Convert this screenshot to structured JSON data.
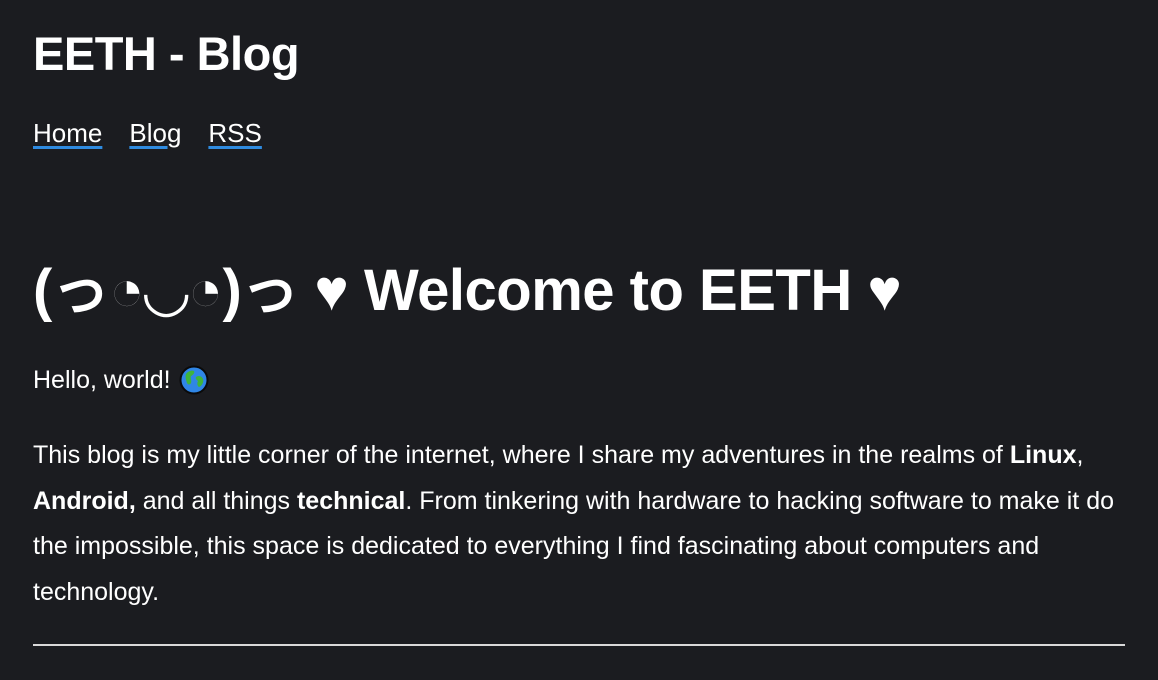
{
  "header": {
    "site_title": "EETH - Blog",
    "nav": [
      {
        "label": "Home"
      },
      {
        "label": "Blog"
      },
      {
        "label": "RSS"
      }
    ]
  },
  "main": {
    "heading": "(っ◔◡◔)っ ♥ Welcome to EETH ♥",
    "hello_text": "Hello, world!",
    "hello_icon": "globe-icon",
    "intro": {
      "part1": "This blog is my little corner of the internet, where I share my adventures in the realms of ",
      "bold_linux": "Linux",
      "sep1": ", ",
      "bold_android": "Android,",
      "part2": " and all things ",
      "bold_technical": "technical",
      "part3": ". From tinkering with hardware to hacking software to make it do the impossible, this space is dedicated to everything I find fascinating about computers and technology."
    }
  },
  "colors": {
    "background": "#1b1c20",
    "text": "#ffffff",
    "link_underline": "#2f8be0",
    "divider": "#d9d9d9"
  }
}
